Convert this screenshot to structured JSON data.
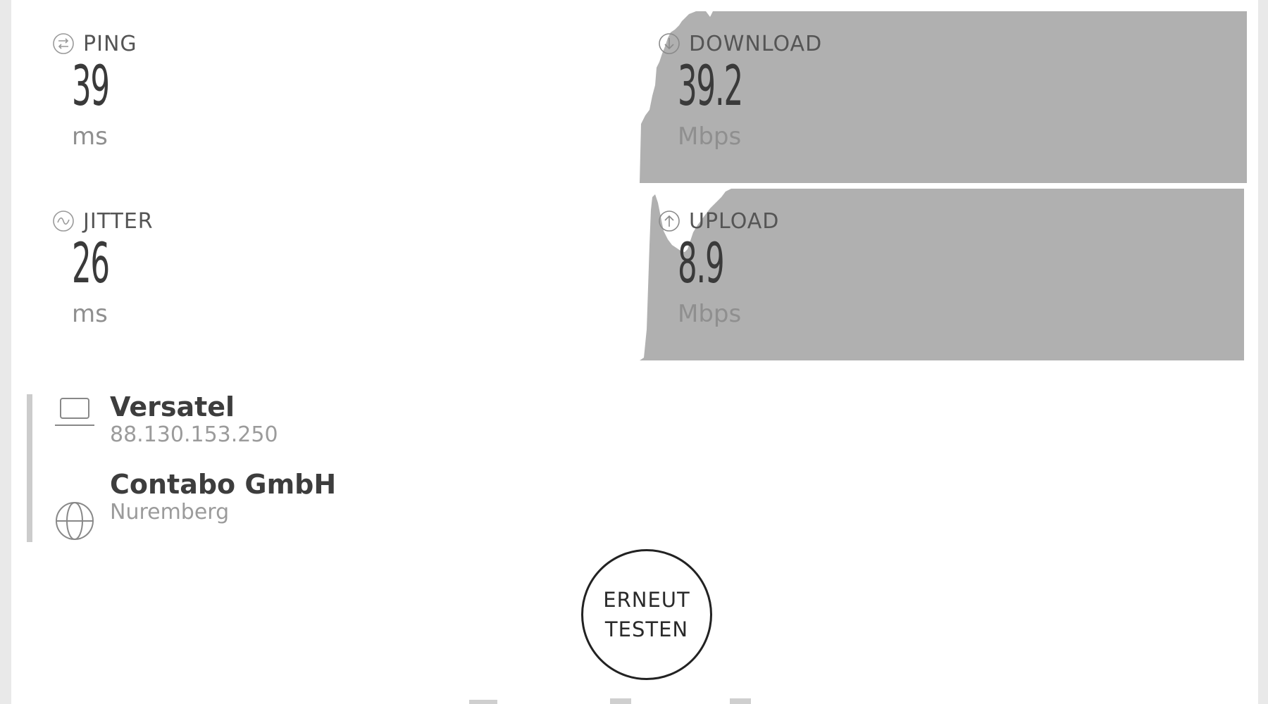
{
  "metrics": {
    "ping": {
      "label": "PING",
      "value": "39",
      "unit": "ms",
      "icon": "ping-icon"
    },
    "jitter": {
      "label": "JITTER",
      "value": "26",
      "unit": "ms",
      "icon": "jitter-icon"
    },
    "download": {
      "label": "DOWNLOAD",
      "value": "39.2",
      "unit": "Mbps",
      "icon": "download-arrow-icon"
    },
    "upload": {
      "label": "UPLOAD",
      "value": "8.9",
      "unit": "Mbps",
      "icon": "upload-arrow-icon"
    }
  },
  "client": {
    "isp": "Versatel",
    "ip": "88.130.153.250",
    "icon": "laptop-icon"
  },
  "server": {
    "host": "Contabo GmbH",
    "location": "Nuremberg",
    "icon": "globe-icon"
  },
  "actions": {
    "retest_line1": "ERNEUT",
    "retest_line2": "TESTEN"
  },
  "colors": {
    "graph_fill": "#b0b0b0",
    "panel_bg": "#ffffff",
    "page_bg": "#e9e9e9",
    "label_text": "#555555",
    "unit_text": "#8f8f8f"
  }
}
